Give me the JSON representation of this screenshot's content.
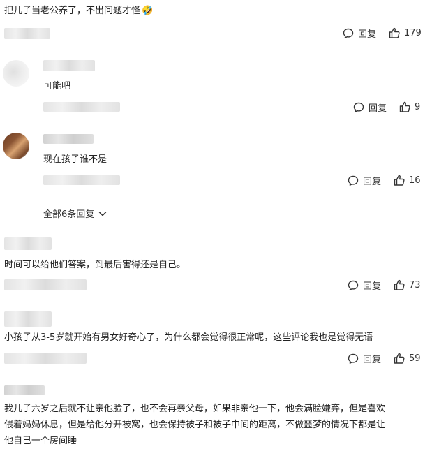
{
  "comments": [
    {
      "text": "把儿子当老公养了，不出问题才怪",
      "emoji": "🤣",
      "reply_label": "回复",
      "likes": "179"
    },
    {
      "text": "可能吧",
      "reply_label": "回复",
      "likes": "9"
    },
    {
      "text": "现在孩子谁不是",
      "reply_label": "回复",
      "likes": "16",
      "all_replies_label": "全部6条回复"
    },
    {
      "text": "时间可以给他们答案，到最后害得还是自己。",
      "reply_label": "回复",
      "likes": "73"
    },
    {
      "text": "小孩子从3-5岁就开始有男女好奇心了，为什么都会觉得很正常呢，这些评论我也是觉得无语",
      "reply_label": "回复",
      "likes": "59"
    },
    {
      "lines": [
        "我儿子六岁之后就不让亲他脸了，也不会再亲父母，如果非亲他一下，他会满脸嫌弃，但是喜欢",
        "偎着妈妈休息，但是给他分开被窝，也会保持被子和被子中间的距离，不做噩梦的情况下都是让",
        "他自己一个房间睡"
      ]
    }
  ],
  "icons": {
    "reply": "comment-bubble-icon",
    "like": "thumbs-up-icon",
    "expand": "chevron-down-icon"
  },
  "colors": {
    "text": "#222222",
    "icon": "#333333",
    "blur": "#e4e4e4"
  }
}
